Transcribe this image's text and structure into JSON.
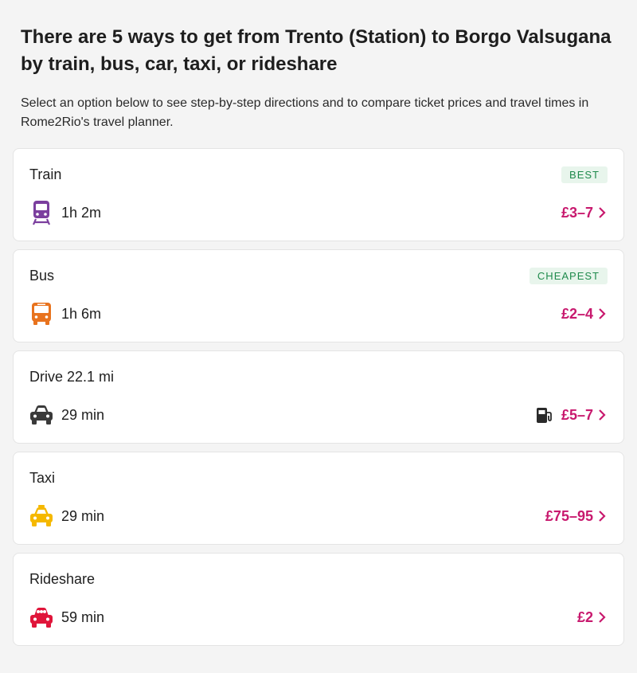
{
  "heading": "There are 5 ways to get from Trento (Station) to Borgo Valsugana by train, bus, car, taxi, or rideshare",
  "intro": "Select an option below to see step-by-step directions and to compare ticket prices and travel times in Rome2Rio's travel planner.",
  "colors": {
    "accent": "#c8196e",
    "badge_text": "#1f8a4c",
    "badge_bg": "#e8f5ec",
    "train": "#7b3f9e",
    "bus": "#e8731e",
    "car": "#3a3a3a",
    "taxi": "#f5b800",
    "rideshare": "#e0153a"
  },
  "options": [
    {
      "title": "Train",
      "badge": "BEST",
      "icon": "train-icon",
      "duration": "1h 2m",
      "price": "£3–7"
    },
    {
      "title": "Bus",
      "badge": "CHEAPEST",
      "icon": "bus-icon",
      "duration": "1h 6m",
      "price": "£2–4"
    },
    {
      "title": "Drive 22.1 mi",
      "badge": "",
      "icon": "car-icon",
      "extra_icon": "fuel-pump-icon",
      "duration": "29 min",
      "price": "£5–7"
    },
    {
      "title": "Taxi",
      "badge": "",
      "icon": "taxi-icon",
      "duration": "29 min",
      "price": "£75–95"
    },
    {
      "title": "Rideshare",
      "badge": "",
      "icon": "rideshare-icon",
      "duration": "59 min",
      "price": "£2"
    }
  ]
}
